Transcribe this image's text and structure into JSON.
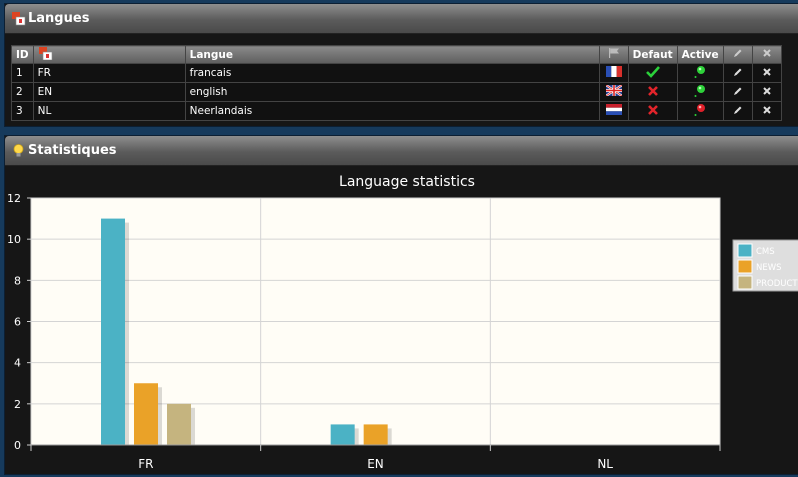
{
  "langues_panel": {
    "title": "Langues",
    "columns": [
      "ID",
      "",
      "Langue",
      "",
      "Defaut",
      "Active",
      "",
      ""
    ],
    "rows": [
      {
        "id": "1",
        "code": "FR",
        "name": "francais",
        "flag": "flag-fr",
        "default": "check",
        "active": "green"
      },
      {
        "id": "2",
        "code": "EN",
        "name": "english",
        "flag": "flag-uk",
        "default": "cross",
        "active": "green"
      },
      {
        "id": "3",
        "code": "NL",
        "name": "Neerlandais",
        "flag": "flag-nl",
        "default": "cross",
        "active": "red"
      }
    ]
  },
  "stats_panel": {
    "title": "Statistiques"
  },
  "chart_data": {
    "type": "bar",
    "title": "Language statistics",
    "categories": [
      "FR",
      "EN",
      "NL"
    ],
    "series": [
      {
        "name": "CMS",
        "values": [
          11,
          1,
          0
        ],
        "color": "#4bb2c5"
      },
      {
        "name": "NEWS",
        "values": [
          3,
          1,
          0
        ],
        "color": "#eaa228"
      },
      {
        "name": "PRODUCT",
        "values": [
          2,
          0,
          0
        ],
        "color": "#c5b47f"
      }
    ],
    "ylim": [
      0,
      12
    ],
    "yticks": [
      "0",
      "2",
      "4",
      "6",
      "8",
      "10",
      "12"
    ],
    "grid": true,
    "legend": "top-right"
  },
  "colors": {
    "header_bg": "#5b5b5b",
    "plot_bg": "#fffdf6",
    "page_bg": "#163a5c"
  }
}
